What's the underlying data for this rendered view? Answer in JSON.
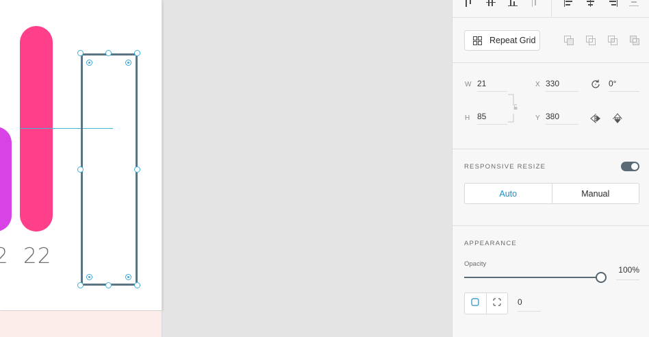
{
  "canvas": {
    "axis_labels": [
      "2",
      "22"
    ],
    "colors": {
      "bar_purple": "#d843e6",
      "bar_pink": "#ff3f8a",
      "selection": "#5b7483",
      "guide": "#3db9d3"
    }
  },
  "inspector": {
    "repeat_grid": {
      "label": "Repeat Grid",
      "icon": "grid-icon"
    },
    "transform": {
      "w_label": "W",
      "w_value": "21",
      "x_label": "X",
      "x_value": "330",
      "h_label": "H",
      "h_value": "85",
      "y_label": "Y",
      "y_value": "380",
      "rotation_value": "0°",
      "icons": [
        "rotate-icon",
        "flip-horizontal-icon",
        "flip-vertical-icon",
        "lock-icon"
      ]
    },
    "responsive_resize": {
      "title": "RESPONSIVE RESIZE",
      "enabled": true,
      "options": {
        "auto": "Auto",
        "manual": "Manual"
      },
      "selected": "Auto"
    },
    "appearance": {
      "title": "APPEARANCE",
      "opacity_label": "Opacity",
      "opacity_value": "100%",
      "opacity_level": 1.0,
      "radius_value": "0"
    },
    "accent_color": "#1b8fc9"
  }
}
